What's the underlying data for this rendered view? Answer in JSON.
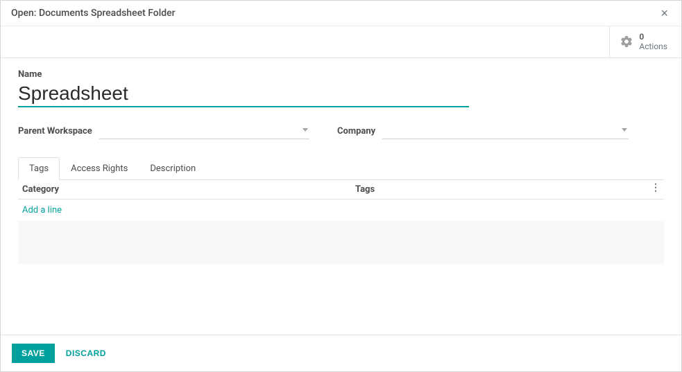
{
  "header": {
    "title": "Open: Documents Spreadsheet Folder"
  },
  "actions": {
    "count": "0",
    "label": "Actions"
  },
  "form": {
    "name_label": "Name",
    "name_value": "Spreadsheet",
    "parent_workspace_label": "Parent Workspace",
    "parent_workspace_value": "",
    "company_label": "Company",
    "company_value": ""
  },
  "tabs": {
    "tags": "Tags",
    "access_rights": "Access Rights",
    "description": "Description"
  },
  "list": {
    "col_category": "Category",
    "col_tags": "Tags",
    "add_line": "Add a line"
  },
  "footer": {
    "save": "SAVE",
    "discard": "DISCARD"
  }
}
